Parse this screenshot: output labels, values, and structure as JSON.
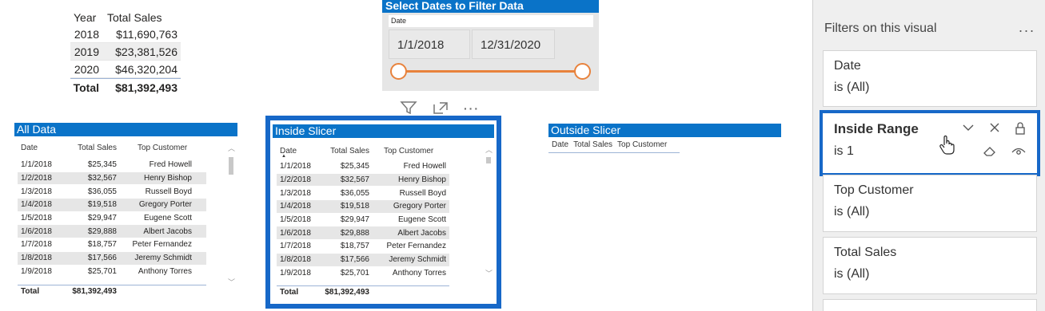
{
  "summary": {
    "headers": [
      "Year",
      "Total Sales"
    ],
    "rows": [
      {
        "year": "2018",
        "sales": "$11,690,763"
      },
      {
        "year": "2019",
        "sales": "$23,381,526"
      },
      {
        "year": "2020",
        "sales": "$46,320,204"
      }
    ],
    "total_label": "Total",
    "total_value": "$81,392,493"
  },
  "slicer": {
    "title": "Select Dates to Filter Data",
    "field": "Date",
    "start": "1/1/2018",
    "end": "12/31/2020",
    "range_fraction": [
      0,
      1
    ]
  },
  "visual_icons": [
    "filter-icon",
    "focus-mode-icon",
    "more-options-icon"
  ],
  "columns": [
    "Date",
    "Total Sales",
    "Top Customer"
  ],
  "all_data": {
    "title": "All Data",
    "rows": [
      [
        "1/1/2018",
        "$25,345",
        "Fred Howell"
      ],
      [
        "1/2/2018",
        "$32,567",
        "Henry Bishop"
      ],
      [
        "1/3/2018",
        "$36,055",
        "Russell Boyd"
      ],
      [
        "1/4/2018",
        "$19,518",
        "Gregory Porter"
      ],
      [
        "1/5/2018",
        "$29,947",
        "Eugene Scott"
      ],
      [
        "1/6/2018",
        "$29,888",
        "Albert Jacobs"
      ],
      [
        "1/7/2018",
        "$18,757",
        "Peter Fernandez"
      ],
      [
        "1/8/2018",
        "$17,566",
        "Jeremy Schmidt"
      ],
      [
        "1/9/2018",
        "$25,701",
        "Anthony Torres"
      ]
    ],
    "total_label": "Total",
    "total_value": "$81,392,493"
  },
  "inside_slicer": {
    "title": "Inside Slicer",
    "rows": [
      [
        "1/1/2018",
        "$25,345",
        "Fred Howell"
      ],
      [
        "1/2/2018",
        "$32,567",
        "Henry Bishop"
      ],
      [
        "1/3/2018",
        "$36,055",
        "Russell Boyd"
      ],
      [
        "1/4/2018",
        "$19,518",
        "Gregory Porter"
      ],
      [
        "1/5/2018",
        "$29,947",
        "Eugene Scott"
      ],
      [
        "1/6/2018",
        "$29,888",
        "Albert Jacobs"
      ],
      [
        "1/7/2018",
        "$18,757",
        "Peter Fernandez"
      ],
      [
        "1/8/2018",
        "$17,566",
        "Jeremy Schmidt"
      ],
      [
        "1/9/2018",
        "$25,701",
        "Anthony Torres"
      ]
    ],
    "total_label": "Total",
    "total_value": "$81,392,493"
  },
  "outside_slicer": {
    "title": "Outside Slicer"
  },
  "filters_pane": {
    "title": "Filters on this visual",
    "more": "...",
    "cards": [
      {
        "name": "Date",
        "state": "is (All)"
      },
      {
        "name": "Inside Range",
        "state": "is 1"
      },
      {
        "name": "Top Customer",
        "state": "is (All)"
      },
      {
        "name": "Total Sales",
        "state": "is (All)"
      }
    ]
  },
  "colors": {
    "accent": "#0a73c8",
    "selection": "#1768c8",
    "slider": "#e8823c"
  }
}
